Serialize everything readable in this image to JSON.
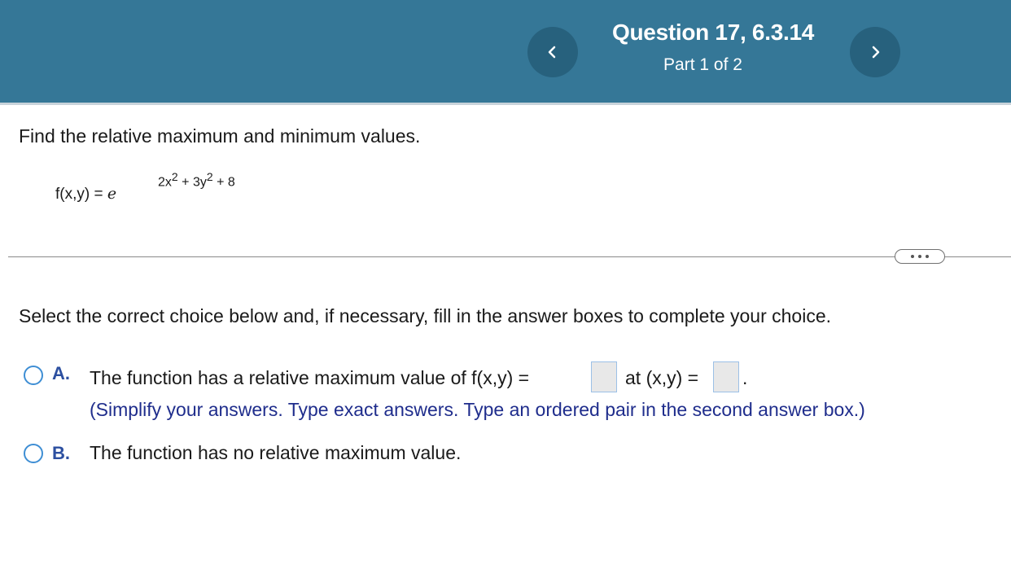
{
  "header": {
    "title": "Question 17, 6.3.14",
    "part": "Part 1 of 2",
    "prev_icon": "chevron-left-icon",
    "next_icon": "chevron-right-icon"
  },
  "question": {
    "prompt": "Find the relative maximum and minimum values.",
    "formula_lhs": "f(x,y) = ",
    "formula_base": "e",
    "formula_exponent": "2x² + 3y² + 8",
    "exp_term1": "2x",
    "exp_term1_power": "2",
    "exp_op1": " + 3y",
    "exp_term2_power": "2",
    "exp_op2": " + 8"
  },
  "more_button_icon": "ellipsis-icon",
  "instruction": "Select the correct choice below and, if necessary, fill in the answer boxes to complete your choice.",
  "choices": [
    {
      "letter": "A.",
      "text_before": "The function has a relative maximum value of f(x,y) =",
      "text_middle": "at (x,y) =",
      "text_after": ".",
      "hint": "(Simplify your answers. Type exact answers. Type an ordered pair in the second answer box.)",
      "answer_1": "",
      "answer_2": ""
    },
    {
      "letter": "B.",
      "text": "The function has no relative maximum value."
    }
  ],
  "colors": {
    "header_bg": "#357797",
    "nav_button_bg": "#27617d",
    "radio_border": "#3e8ed4",
    "letter": "#2c4fa0",
    "hint": "#1f2d8c"
  }
}
